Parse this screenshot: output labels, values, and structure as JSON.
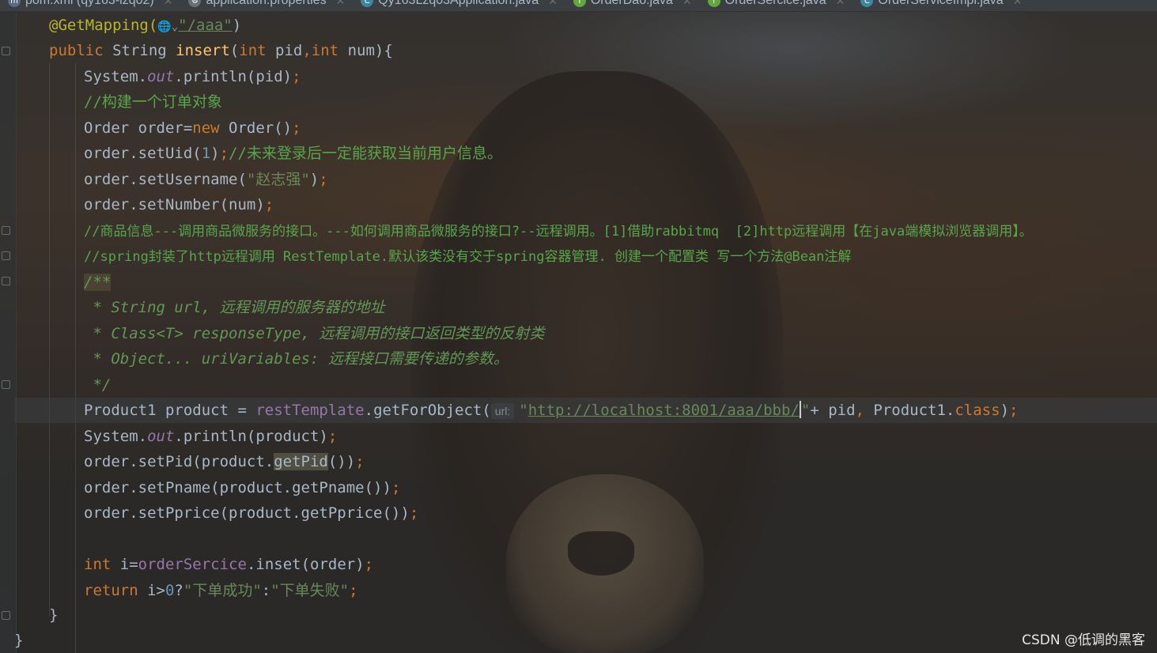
{
  "tabs": [
    {
      "label": "pom.xml (qy163-lzq02)",
      "icon": "maven-icon"
    },
    {
      "label": "application.properties",
      "icon": "config-icon"
    },
    {
      "label": "Qy163Lzq03Application.java",
      "icon": "app-class-icon"
    },
    {
      "label": "OrderDao.java",
      "icon": "interface-icon"
    },
    {
      "label": "OrderSercice.java",
      "icon": "interface-icon"
    },
    {
      "label": "OrderServiceImpl.java",
      "icon": "class-icon"
    }
  ],
  "code": {
    "l1_ann": "@GetMapping(",
    "l1_globe": "🌐⌄",
    "l1_path": "\"/aaa\"",
    "l1_end": ")",
    "l2_public": "public",
    "l2_a": " String ",
    "l2_meth": "insert",
    "l2_b": "(",
    "l2_int1": "int",
    "l2_c": " pid",
    "l2_comma": ",",
    "l2_int2": "int",
    "l2_d": " num){",
    "l3_a": "System.",
    "l3_out": "out",
    "l3_b": ".println(pid)",
    "semi": ";",
    "l4_cmt": "//构建一个订单对象",
    "l5_a": "Order order=",
    "l5_new": "new",
    "l5_b": " Order()",
    "l6_a": "order.setUid(",
    "l6_num": "1",
    "l6_b": ")",
    "l6_cmt": "//未来登录后一定能获取当前用户信息。",
    "l7_a": "order.setUsername(",
    "l7_str": "\"赵志强\"",
    "l7_b": ")",
    "l8_a": "order.setNumber(num)",
    "l9_cmt": "//商品信息---调用商品微服务的接口。---如何调用商品微服务的接口?--远程调用。[1]借助rabbitmq  [2]http远程调用【在java端模拟浏览器调用】。",
    "l10_cmt": "//spring封装了http远程调用 RestTemplate.默认该类没有交于spring容器管理. 创建一个配置类 写一个方法@Bean注解",
    "l11_doc": "/**",
    "l12_doc": " * String url, 远程调用的服务器的地址",
    "l13_doc": " * Class<T> responseType, 远程调用的接口返回类型的反射类",
    "l14_doc": " * Object... uriVariables: 远程接口需要传递的参数。",
    "l15_doc": " */",
    "l16_a": "Product1 product = ",
    "l16_field": "restTemplate",
    "l16_b": ".getForObject(",
    "l16_hint": "url:",
    "l16_q": "\"",
    "l16_url": "http://localhost:8001/aaa/bbb/",
    "l16_q2": "\"",
    "l16_c": "+ pid",
    "l16_comma": ",",
    "l16_d": " Product1.",
    "l16_class": "class",
    "l16_e": ")",
    "l17_a": "System.",
    "l17_out": "out",
    "l17_b": ".println(product)",
    "l18_a": "order.setPid(product.",
    "l18_hl": "getPid",
    "l18_b": "())",
    "l19_a": "order.setPname(product.getPname())",
    "l20_a": "order.setPprice(product.getPprice())",
    "l22_int": "int",
    "l22_a": " i=",
    "l22_field": "orderSercice",
    "l22_b": ".inset(order)",
    "l23_ret": "return",
    "l23_a": " i>",
    "l23_num": "0",
    "l23_b": "?",
    "l23_s1": "\"下单成功\"",
    "l23_c": ":",
    "l23_s2": "\"下单失败\"",
    "l24_a": "}",
    "l25_a": "}"
  },
  "watermark": "CSDN @低调的黑客"
}
